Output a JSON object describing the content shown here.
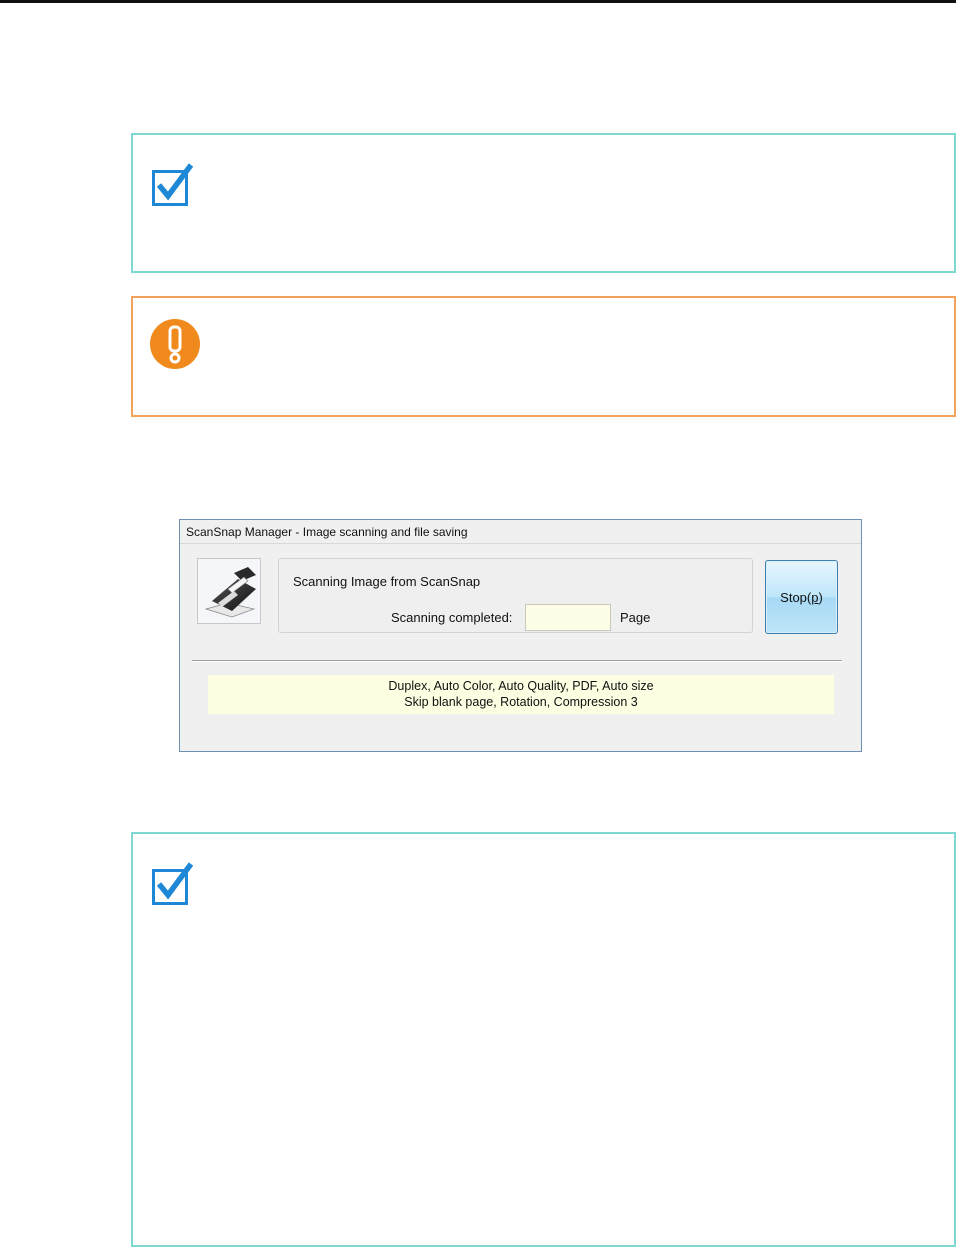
{
  "dialog": {
    "title": "ScanSnap Manager - Image scanning and file saving",
    "status_title": "Scanning Image from ScanSnap",
    "completed_label": "Scanning completed:",
    "page_count_value": "",
    "page_label": "Page",
    "stop_button": {
      "text": "Stop(",
      "mnemonic": "p",
      "close": ")"
    },
    "settings_line1": "Duplex, Auto Color, Auto Quality, PDF, Auto size",
    "settings_line2": "Skip blank page, Rotation, Compression 3"
  },
  "colors": {
    "hint_border": "#7dd8d2",
    "caution_border": "#f2a25a",
    "hint_icon_blue": "#1e88d6",
    "caution_icon_orange": "#f08a1d",
    "settings_background": "#fefee2",
    "stop_button_blue": "#bee6fb"
  },
  "icons": {
    "hint": "checkmark-note-icon",
    "caution": "exclamation-caution-icon",
    "scanner": "scanner-icon"
  }
}
